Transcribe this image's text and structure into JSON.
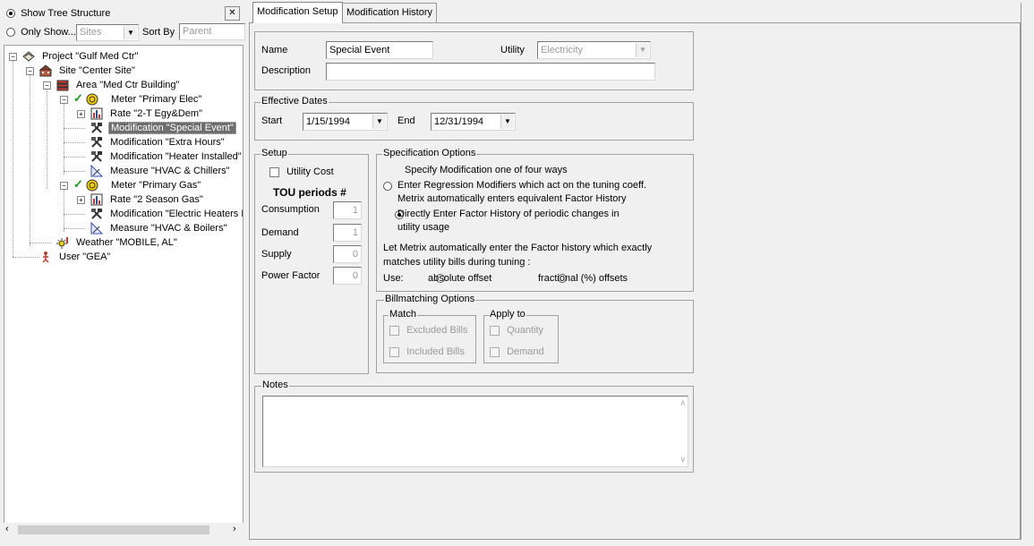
{
  "left": {
    "show_tree_label": "Show Tree Structure",
    "only_show_label": "Only Show...",
    "only_show_select": "Sites",
    "sort_by_label": "Sort By",
    "sort_by_value": "Parent",
    "close_symbol": "✕",
    "tree": [
      {
        "label": "Project \"Gulf Med Ctr\"",
        "icon": "project-icon"
      },
      {
        "label": "Site \"Center Site\"",
        "icon": "site-icon"
      },
      {
        "label": "Area \"Med Ctr Building\"",
        "icon": "area-icon"
      },
      {
        "label": "Meter \"Primary Elec\"",
        "icon": "meter-icon"
      },
      {
        "label": "Rate \"2-T Egy&Dem\"",
        "icon": "rate-icon"
      },
      {
        "label": "Modification \"Special Event\"",
        "icon": "modification-icon"
      },
      {
        "label": "Modification \"Extra Hours\"",
        "icon": "modification-icon"
      },
      {
        "label": "Modification \"Heater Installed\"",
        "icon": "modification-icon"
      },
      {
        "label": "Measure \"HVAC & Chillers\"",
        "icon": "measure-icon"
      },
      {
        "label": "Meter \"Primary Gas\"",
        "icon": "meter-icon"
      },
      {
        "label": "Rate \"2 Season Gas\"",
        "icon": "rate-icon"
      },
      {
        "label": "Modification \"Electric Heaters B",
        "icon": "modification-icon"
      },
      {
        "label": "Measure \"HVAC & Boilers\"",
        "icon": "measure-icon"
      },
      {
        "label": "Weather \"MOBILE, AL\"",
        "icon": "weather-icon"
      },
      {
        "label": "User \"GEA\"",
        "icon": "user-icon"
      }
    ]
  },
  "tabs": [
    {
      "label": "Modification Setup"
    },
    {
      "label": "Modification History"
    }
  ],
  "form": {
    "name_label": "Name",
    "name_value": "Special Event",
    "utility_label": "Utility",
    "utility_value": "Electricity",
    "description_label": "Description",
    "description_value": "",
    "effective_dates_label": "Effective Dates",
    "start_label": "Start",
    "start_value": "1/15/1994",
    "end_label": "End",
    "end_value": "12/31/1994",
    "setup_label": "Setup",
    "utility_cost_label": "Utility Cost",
    "tou_label": "TOU periods #",
    "consumption_label": "Consumption",
    "consumption_value": "1",
    "demand_label": "Demand",
    "demand_value": "1",
    "supply_label": "Supply",
    "supply_value": "0",
    "power_factor_label": "Power Factor",
    "power_factor_value": "0",
    "spec_label": "Specification Options",
    "spec_intro": "Specify Modification one of four ways",
    "spec_opt1_line1": "Enter Regression Modifiers which act on the tuning coeff.",
    "spec_opt1_line2": "Metrix automatically enters equivalent Factor History",
    "spec_opt2_line1": "Directly Enter Factor History of periodic changes in",
    "spec_opt2_line2": "utility usage",
    "spec_auto_line1": "Let Metrix automatically enter the Factor history which exactly",
    "spec_auto_line2": "matches utility bills during tuning :",
    "use_label": "Use:",
    "absolute_offset_label": "absolute offset",
    "fractional_offset_label": "fractional (%) offsets",
    "billmatching_label": "Billmatching Options",
    "match_label": "Match",
    "excluded_bills_label": "Excluded Bills",
    "included_bills_label": "Included Bills",
    "apply_to_label": "Apply to",
    "quantity_label": "Quantity",
    "demand_apply_label": "Demand",
    "notes_label": "Notes",
    "notes_value": ""
  }
}
